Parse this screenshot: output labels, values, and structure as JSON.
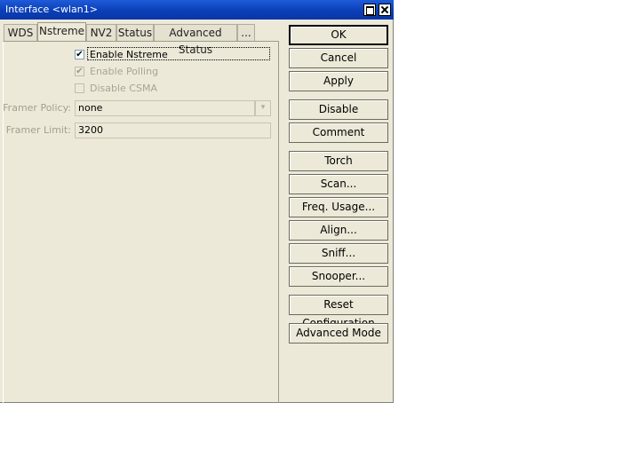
{
  "window": {
    "title": "Interface <wlan1>"
  },
  "tabs": [
    {
      "label": "WDS",
      "active": false
    },
    {
      "label": "Nstreme",
      "active": true
    },
    {
      "label": "NV2",
      "active": false
    },
    {
      "label": "Status",
      "active": false
    },
    {
      "label": "Advanced Status",
      "active": false
    },
    {
      "label": "...",
      "active": false
    }
  ],
  "nstreme": {
    "enable_nstreme": {
      "label": "Enable Nstreme",
      "checked": true,
      "enabled": true
    },
    "enable_polling": {
      "label": "Enable Polling",
      "checked": true,
      "enabled": false
    },
    "disable_csma": {
      "label": "Disable CSMA",
      "checked": false,
      "enabled": false
    },
    "framer_policy": {
      "label": "Framer Policy:",
      "value": "none"
    },
    "framer_limit": {
      "label": "Framer Limit:",
      "value": "3200"
    }
  },
  "buttons": {
    "ok": "OK",
    "cancel": "Cancel",
    "apply": "Apply",
    "disable": "Disable",
    "comment": "Comment",
    "torch": "Torch",
    "scan": "Scan...",
    "freq_usage": "Freq. Usage...",
    "align": "Align...",
    "sniff": "Sniff...",
    "snooper": "Snooper...",
    "reset_configuration": "Reset Configuration",
    "advanced_mode": "Advanced Mode"
  },
  "icons": {
    "checkmark": "✔",
    "dropdown": "▾"
  }
}
